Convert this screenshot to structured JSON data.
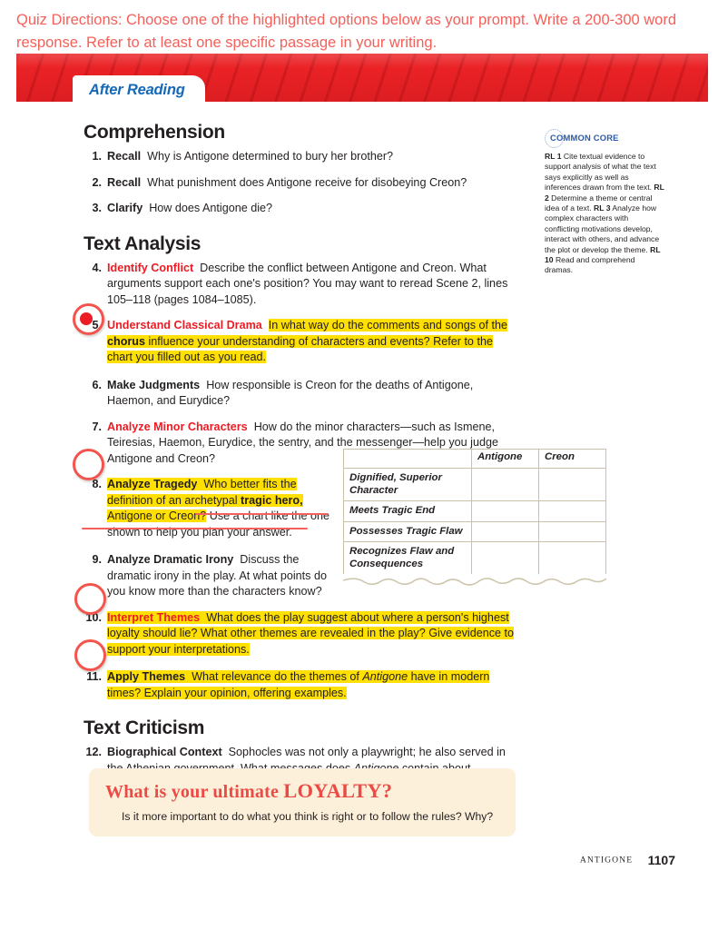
{
  "directions": {
    "text": "Quiz Directions: Choose one of the highlighted options below as your prompt. Write a 200-300 word response. Refer to at least one specific passage in your writing.",
    "color": "#f4605a"
  },
  "banner": {
    "tab_label": "After Reading",
    "banner_color": "#ea2226",
    "tab_text_color": "#1669b7"
  },
  "sections": {
    "comprehension_title": "Comprehension",
    "text_analysis_title": "Text Analysis",
    "text_criticism_title": "Text Criticism"
  },
  "questions": [
    {
      "num": "1.",
      "label": "Recall",
      "label_color": "black",
      "text": "Why is Antigone determined to bury her brother?"
    },
    {
      "num": "2.",
      "label": "Recall",
      "label_color": "black",
      "text": "What punishment does Antigone receive for disobeying Creon?"
    },
    {
      "num": "3.",
      "label": "Clarify",
      "label_color": "black",
      "text": "How does Antigone die?"
    },
    {
      "num": "4.",
      "label": "Identify Conflict",
      "label_color": "red",
      "text": "Describe the conflict between Antigone and Creon.  What arguments support each one's position?  You may want to reread Scene 2, lines 105–118 (pages 1084–1085)."
    },
    {
      "num": "5.",
      "label": "Understand Classical Drama",
      "label_color": "red",
      "highlighted": true,
      "text_part1": "In what way do the comments and songs of the ",
      "text_bold": "chorus",
      "text_part2": " influence your understanding of characters and events?  Refer to the chart you filled out as you read."
    },
    {
      "num": "6.",
      "label": "Make Judgments",
      "label_color": "black",
      "text": "How responsible is Creon for the deaths of Antigone, Haemon, and Eurydice?"
    },
    {
      "num": "7.",
      "label": "Analyze Minor Characters",
      "label_color": "red",
      "text": "How do the minor characters—such as Ismene, Teiresias, Haemon, Eurydice, the sentry, and the messenger—help you judge Antigone and Creon?"
    },
    {
      "num": "8.",
      "label": "Analyze Tragedy",
      "label_color": "black",
      "highlighted": true,
      "text_part1": "Who better fits the definition of an archetypal ",
      "text_bold": "tragic hero,",
      "text_part2": " Antigone or Creon?",
      "struck_text": "Use a chart like the one shown to help you plan your answer."
    },
    {
      "num": "9.",
      "label": "Analyze Dramatic Irony",
      "label_color": "black",
      "text": "Discuss the dramatic irony in the play.  At what points do you know more than the characters know?"
    },
    {
      "num": "10.",
      "label": "Interpret Themes",
      "label_color": "red",
      "highlighted": true,
      "text": "What does the play suggest about where a person's highest loyalty should lie?  What other themes are revealed in the play?  Give evidence to support your interpretations."
    },
    {
      "num": "11.",
      "label": "Apply Themes",
      "label_color": "black",
      "highlighted": true,
      "text_part1": "What relevance do the themes of ",
      "text_italic": "Antigone",
      "text_part2": " have in modern times?  Explain your opinion, offering examples."
    },
    {
      "num": "12.",
      "label": "Biographical Context",
      "label_color": "black",
      "text_part1": "Sophocles was not only a playwright; he also served in the Athenian government.  What messages does ",
      "text_italic": "Antigone",
      "text_part2": " contain about democracy and the government of states?"
    }
  ],
  "common_core": {
    "badge": "COMMON CORE",
    "badge_color": "#2b5aa8",
    "standards": [
      {
        "code": "RL 1",
        "text": "Cite textual evidence to support analysis of what the text says explicitly as well as inferences drawn from the text."
      },
      {
        "code": "RL 2",
        "text": "Determine a theme or central idea of a text."
      },
      {
        "code": "RL 3",
        "text": "Analyze how complex characters with conflicting motivations develop, interact with others, and advance the plot or develop the theme."
      },
      {
        "code": "RL 10",
        "text": "Read and comprehend dramas."
      }
    ]
  },
  "chart_data": {
    "type": "table",
    "title": "",
    "columns": [
      "",
      "Antigone",
      "Creon"
    ],
    "rows": [
      {
        "criterion": "Dignified, Superior Character",
        "antigone": "",
        "creon": ""
      },
      {
        "criterion": "Meets Tragic End",
        "antigone": "",
        "creon": ""
      },
      {
        "criterion": "Possesses Tragic Flaw",
        "antigone": "",
        "creon": ""
      },
      {
        "criterion": "Recognizes Flaw and Consequences",
        "antigone": "",
        "creon": ""
      }
    ]
  },
  "loyalty_box": {
    "heading_part1": "What is your ultimate ",
    "heading_part2": "LOYALTY?",
    "prompt": "Is it more important to do what you think is right or to follow the rules? Why?",
    "bg_color": "#fdf0da",
    "heading_color": "#ec4a45"
  },
  "footer": {
    "book_title": "ANTIGONE",
    "page_number": "1107"
  },
  "annotations": {
    "highlight_color": "#ffe000",
    "circle_color": "#f4544c",
    "strike_color": "#f4605a"
  }
}
